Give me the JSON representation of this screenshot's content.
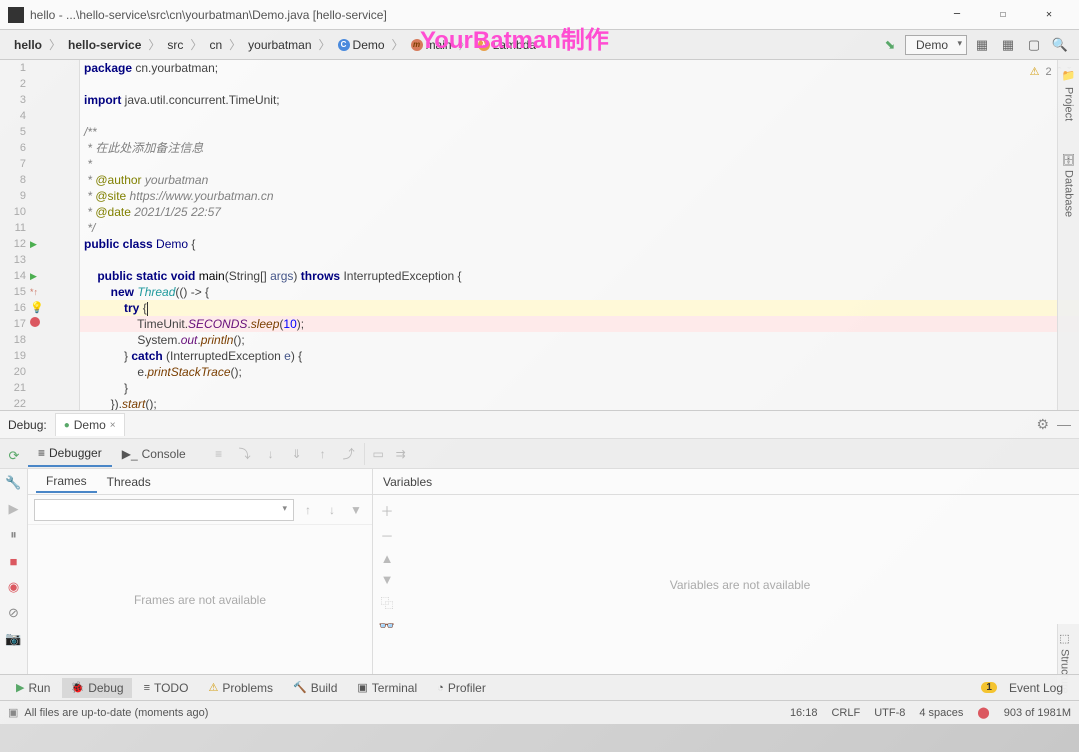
{
  "title": "hello - ...\\hello-service\\src\\cn\\yourbatman\\Demo.java [hello-service]",
  "watermark": "YourBatman制作",
  "breadcrumbs": [
    "hello",
    "hello-service",
    "src",
    "cn",
    "yourbatman"
  ],
  "breadcrumbs_ex": [
    {
      "icon": "class",
      "label": "Demo"
    },
    {
      "icon": "method",
      "label": "main"
    },
    {
      "icon": "lambda",
      "label": "Lambda"
    }
  ],
  "run_config": "Demo",
  "inspection": {
    "warnings": "2"
  },
  "code_lines": [
    "package cn.yourbatman;",
    "",
    "import java.util.concurrent.TimeUnit;",
    "",
    "/**",
    " * 在此处添加备注信息",
    " *",
    " * @author yourbatman",
    " * @site https://www.yourbatman.cn",
    " * @date 2021/1/25 22:57",
    " */",
    "public class Demo {",
    "",
    "    public static void main(String[] args) throws InterruptedException {",
    "        new Thread(() -> {",
    "            try {",
    "                TimeUnit.SECONDS.sleep(10);",
    "                System.out.println();",
    "            } catch (InterruptedException e) {",
    "                e.printStackTrace();",
    "            }",
    "        }).start();"
  ],
  "debug": {
    "title": "Debug:",
    "session": "Demo",
    "tabs": {
      "debugger": "Debugger",
      "console": "Console"
    },
    "frames": {
      "tab_frames": "Frames",
      "tab_threads": "Threads",
      "empty": "Frames are not available"
    },
    "variables": {
      "title": "Variables",
      "empty": "Variables are not available"
    }
  },
  "tools": {
    "run": "Run",
    "debug": "Debug",
    "todo": "TODO",
    "problems": "Problems",
    "build": "Build",
    "terminal": "Terminal",
    "profiler": "Profiler",
    "event_log": "Event Log",
    "event_count": "1"
  },
  "status": {
    "message": "All files are up-to-date (moments ago)",
    "position": "16:18",
    "line_sep": "CRLF",
    "encoding": "UTF-8",
    "indent": "4 spaces",
    "memory": "903 of 1981M"
  },
  "right_tabs": {
    "project": "Project",
    "database": "Database",
    "structure": "Structure"
  }
}
